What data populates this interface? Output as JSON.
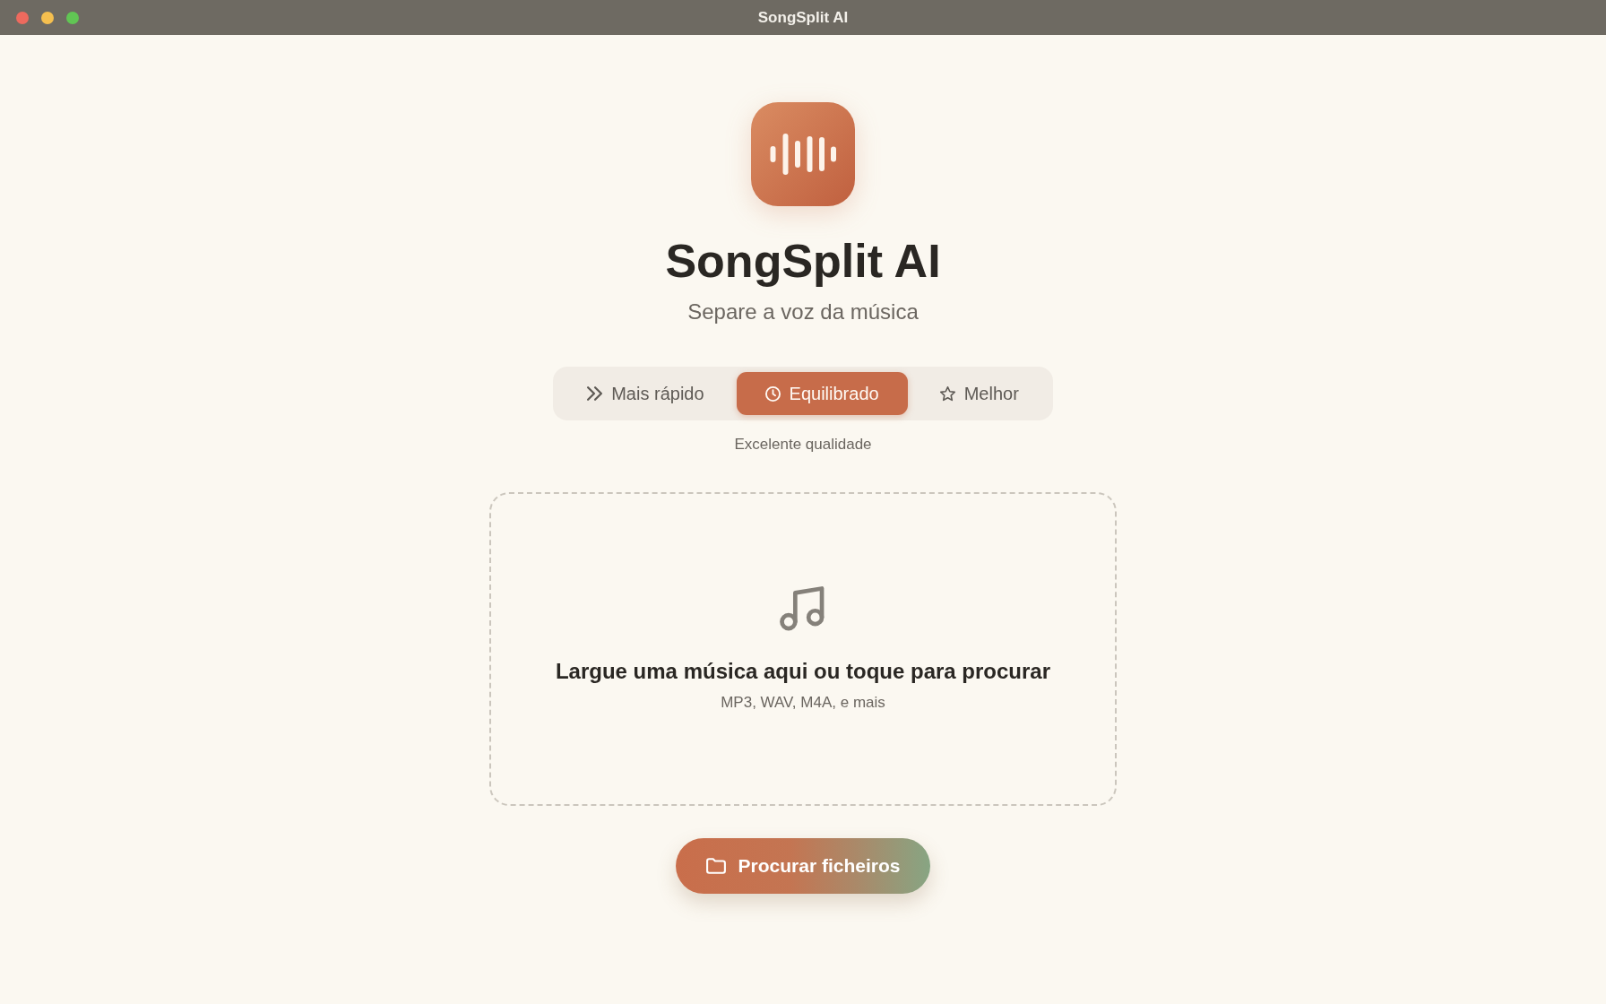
{
  "window": {
    "title": "SongSplit AI"
  },
  "app": {
    "name": "SongSplit AI",
    "tagline": "Separe a voz da música"
  },
  "quality_modes": [
    {
      "kind": "fast",
      "label": "Mais rápido",
      "selected": false
    },
    {
      "kind": "balanced",
      "label": "Equilibrado",
      "selected": true
    },
    {
      "kind": "best",
      "label": "Melhor",
      "selected": false
    }
  ],
  "quality_description": "Excelente qualidade",
  "drop_zone": {
    "title": "Largue uma música aqui ou toque para procurar",
    "formats": "MP3, WAV, M4A, e mais"
  },
  "browse_button": {
    "label": "Procurar ficheiros"
  }
}
